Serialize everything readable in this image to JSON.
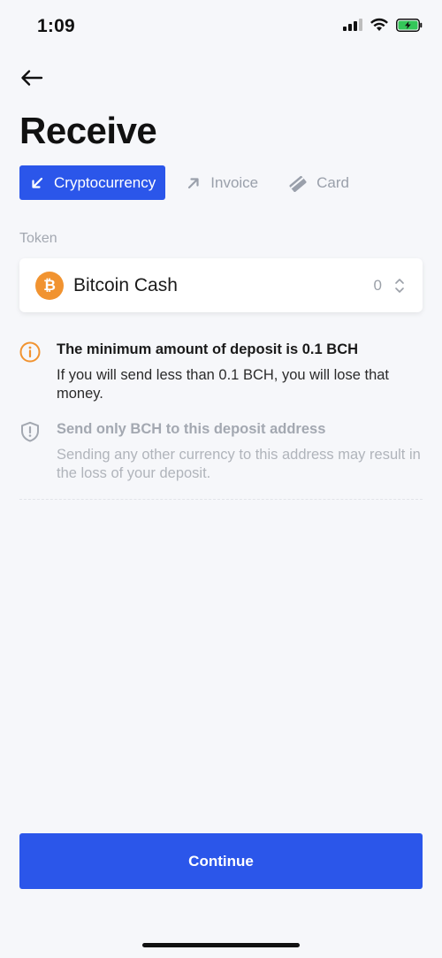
{
  "status_bar": {
    "time": "1:09",
    "icons": [
      "signal-icon",
      "wifi-icon",
      "battery-charging-icon"
    ]
  },
  "header": {
    "back_icon": "arrow-left-icon",
    "title": "Receive"
  },
  "tabs": [
    {
      "label": "Cryptocurrency",
      "icon": "arrow-down-left-icon",
      "active": true
    },
    {
      "label": "Invoice",
      "icon": "arrow-up-right-icon",
      "active": false
    },
    {
      "label": "Card",
      "icon": "card-icon",
      "active": false
    }
  ],
  "token": {
    "label": "Token",
    "selected_name": "Bitcoin Cash",
    "balance": "0",
    "icon": "bitcoin-icon"
  },
  "notices": [
    {
      "icon": "info-circle-icon",
      "title": "The minimum amount of deposit is 0.1 BCH",
      "text": "If you will send less than 0.1 BCH, you will lose that money."
    },
    {
      "icon": "shield-alert-icon",
      "title": "Send only BCH to this deposit address",
      "text": "Sending any other currency to this address may result in the loss of your deposit."
    }
  ],
  "actions": {
    "continue_label": "Continue"
  },
  "colors": {
    "accent": "#2b56ea",
    "warning": "#f19330",
    "background": "#f6f7fa"
  }
}
